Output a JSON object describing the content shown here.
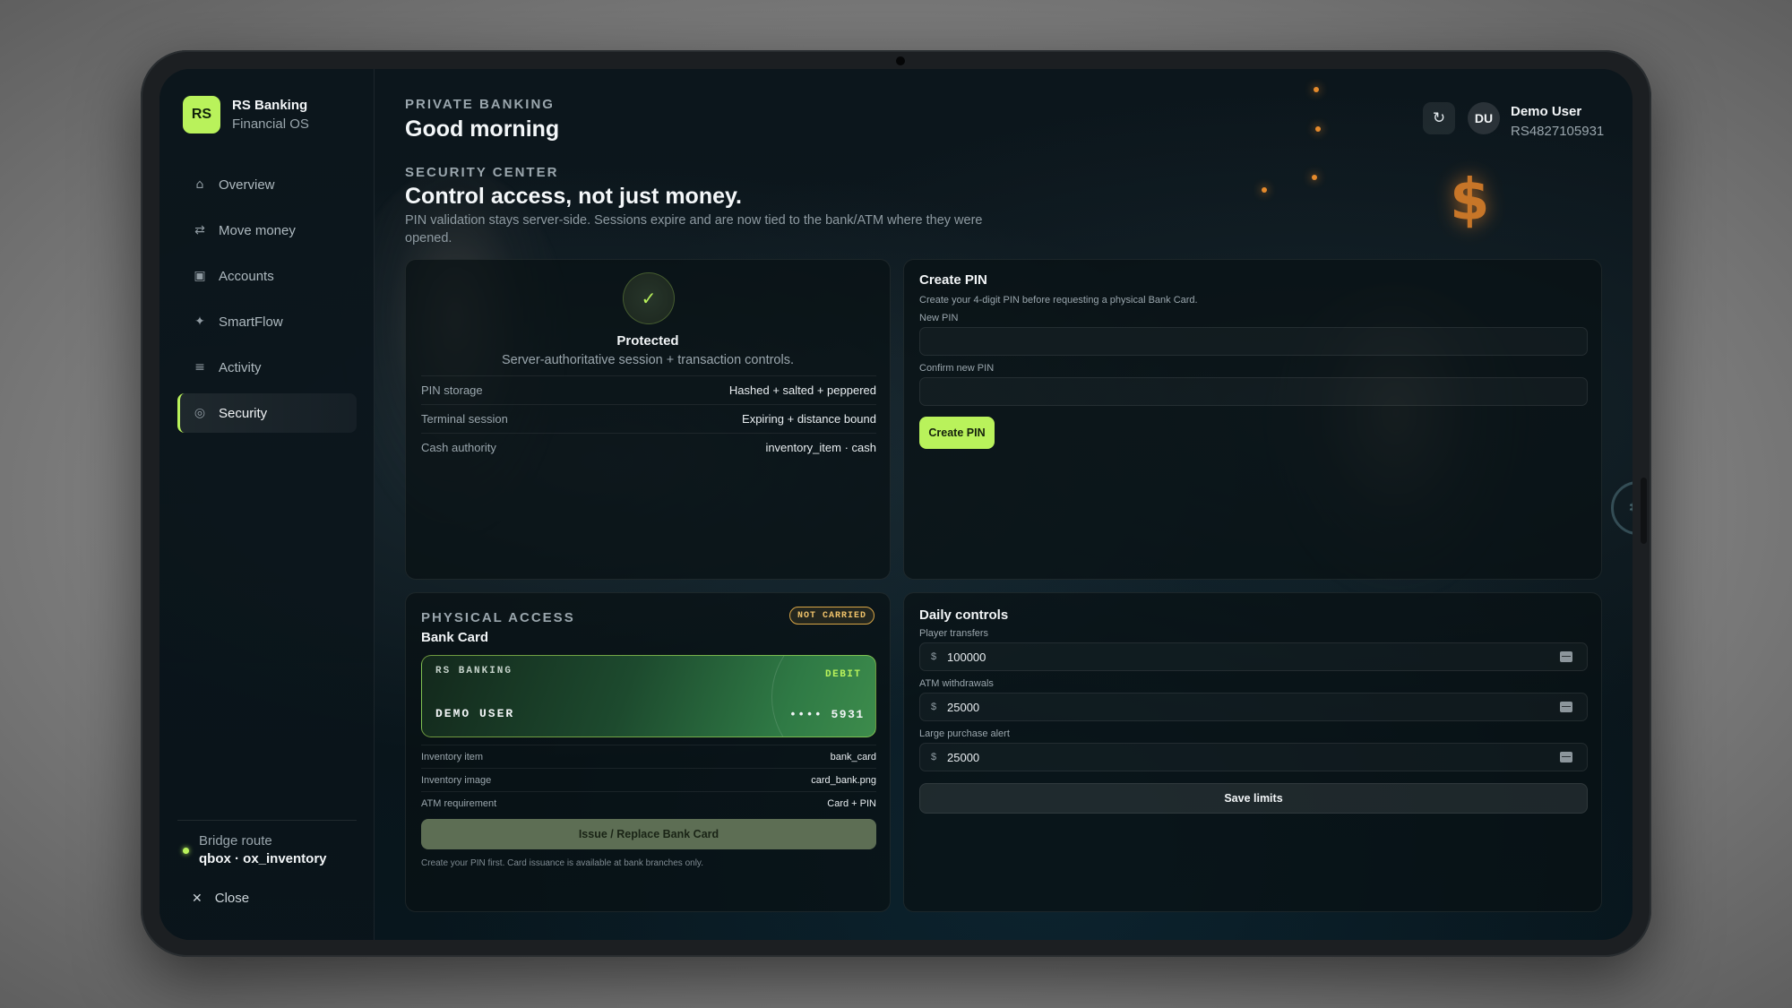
{
  "brand": {
    "logo": "RS",
    "name": "RS Banking",
    "subtitle": "Financial OS"
  },
  "sidebar": {
    "items": [
      {
        "label": "Overview",
        "icon": "home-icon",
        "glyph": "⌂"
      },
      {
        "label": "Move money",
        "icon": "transfer-icon",
        "glyph": "⇄"
      },
      {
        "label": "Accounts",
        "icon": "accounts-icon",
        "glyph": "▣"
      },
      {
        "label": "SmartFlow",
        "icon": "sparkle-icon",
        "glyph": "✦"
      },
      {
        "label": "Activity",
        "icon": "list-icon",
        "glyph": "≡"
      },
      {
        "label": "Security",
        "icon": "security-icon",
        "glyph": "◎",
        "active": true
      }
    ],
    "bridge_label": "Bridge route",
    "bridge_value": "qbox · ox_inventory",
    "close_label": "Close"
  },
  "header": {
    "eyebrow": "PRIVATE BANKING",
    "title": "Good morning",
    "refresh_glyph": "↻",
    "user_initials": "DU",
    "user_name": "Demo User",
    "user_id": "RS4827105931"
  },
  "security": {
    "eyebrow": "SECURITY CENTER",
    "title": "Control access, not just money.",
    "description": "PIN validation stays server-side. Sessions expire and are now tied to the bank/ATM where they were opened."
  },
  "protection": {
    "status_glyph": "✓",
    "status": "Protected",
    "subtitle": "Server-authoritative session + transaction controls.",
    "rows": [
      {
        "key": "PIN storage",
        "value": "Hashed + salted + peppered"
      },
      {
        "key": "Terminal session",
        "value": "Expiring + distance bound"
      },
      {
        "key": "Cash authority",
        "value": "inventory_item · cash"
      }
    ]
  },
  "create_pin": {
    "title": "Create PIN",
    "description": "Create your 4-digit PIN before requesting a physical Bank Card.",
    "new_pin_label": "New PIN",
    "new_pin_value": "",
    "confirm_label": "Confirm new PIN",
    "confirm_value": "",
    "button": "Create PIN"
  },
  "physical_access": {
    "eyebrow": "PHYSICAL ACCESS",
    "badge": "NOT CARRIED",
    "title": "Bank Card",
    "card": {
      "bank": "RS BANKING",
      "type": "DEBIT",
      "holder": "DEMO USER",
      "number": "•••• 5931"
    },
    "rows": [
      {
        "key": "Inventory item",
        "value": "bank_card"
      },
      {
        "key": "Inventory image",
        "value": "card_bank.png"
      },
      {
        "key": "ATM requirement",
        "value": "Card + PIN"
      }
    ],
    "button": "Issue / Replace Bank Card",
    "note": "Create your PIN first. Card issuance is available at bank branches only."
  },
  "daily_controls": {
    "title": "Daily controls",
    "fields": [
      {
        "label": "Player transfers",
        "currency": "$",
        "value": "100000"
      },
      {
        "label": "ATM withdrawals",
        "currency": "$",
        "value": "25000"
      },
      {
        "label": "Large purchase alert",
        "currency": "$",
        "value": "25000"
      }
    ],
    "button": "Save limits"
  },
  "colors": {
    "accent": "#b9f25b",
    "badge": "#d8a546",
    "background": "#0a1419"
  }
}
